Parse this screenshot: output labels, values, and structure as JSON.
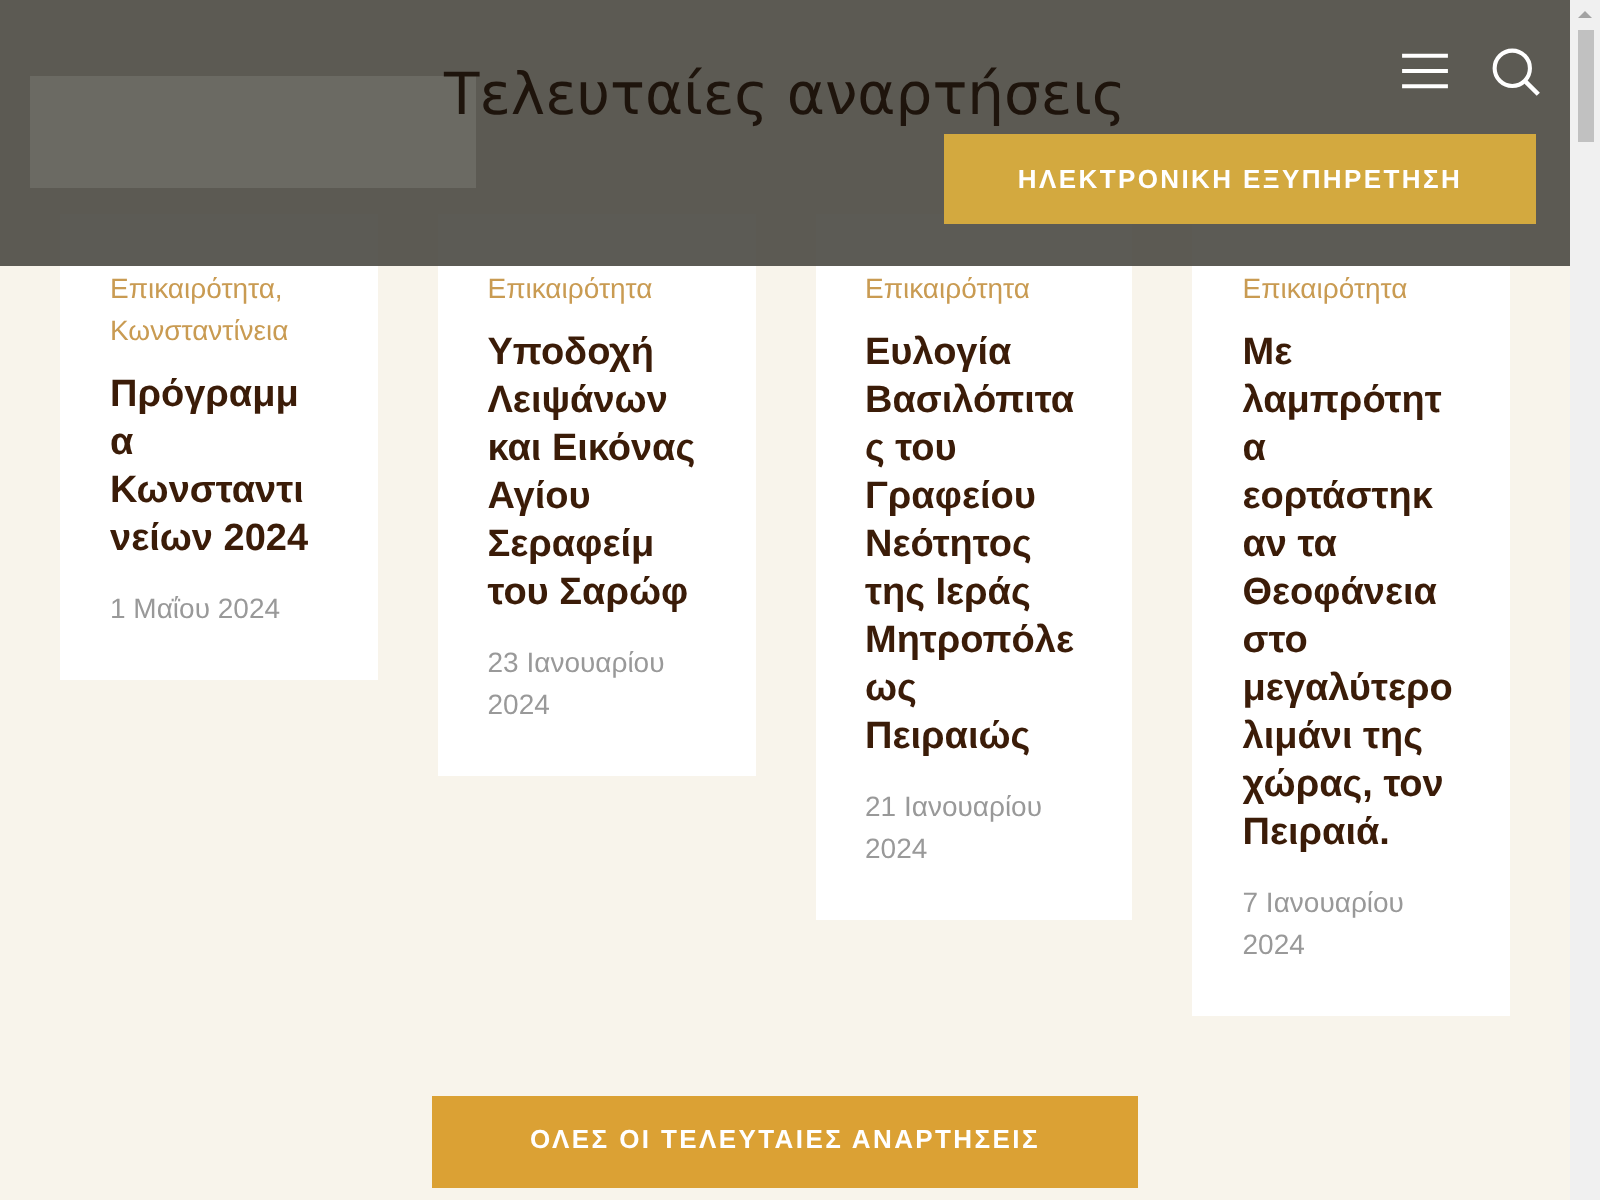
{
  "header": {
    "service_button": "ΗΛΕΚΤΡΟΝΙΚΗ ΕΞΥΠΗΡΕΤΗΣΗ"
  },
  "section_title": "Τελευταίες αναρτήσεις",
  "posts": [
    {
      "category": "Επικαιρότητα, Κωνσταντίνεια",
      "title": "Πρόγραμμα Κωνσταντινείων 2024",
      "date": "1 Μαΐου 2024"
    },
    {
      "category": "Επικαιρότητα",
      "title": "Υποδοχή Λειψάνων και Εικόνας Αγίου Σεραφείμ του Σαρώφ",
      "date": "23 Ιανουαρίου 2024"
    },
    {
      "category": "Επικαιρότητα",
      "title": "Ευλογία Βασιλόπιτας του Γραφείου Νεότητος της Ιεράς Μητροπόλεως Πειραιώς",
      "date": "21 Ιανουαρίου 2024"
    },
    {
      "category": "Επικαιρότητα",
      "title": "Με λαμπρότητα εορτάστηκαν τα Θεοφάνεια στο μεγαλύτερο λιμάνι της χώρας, τον Πειραιά.",
      "date": "7 Ιανουαρίου 2024"
    }
  ],
  "all_posts_button": "ΟΛΕΣ ΟΙ ΤΕΛΕΥΤΑΙΕΣ ΑΝΑΡΤΗΣΕΙΣ"
}
